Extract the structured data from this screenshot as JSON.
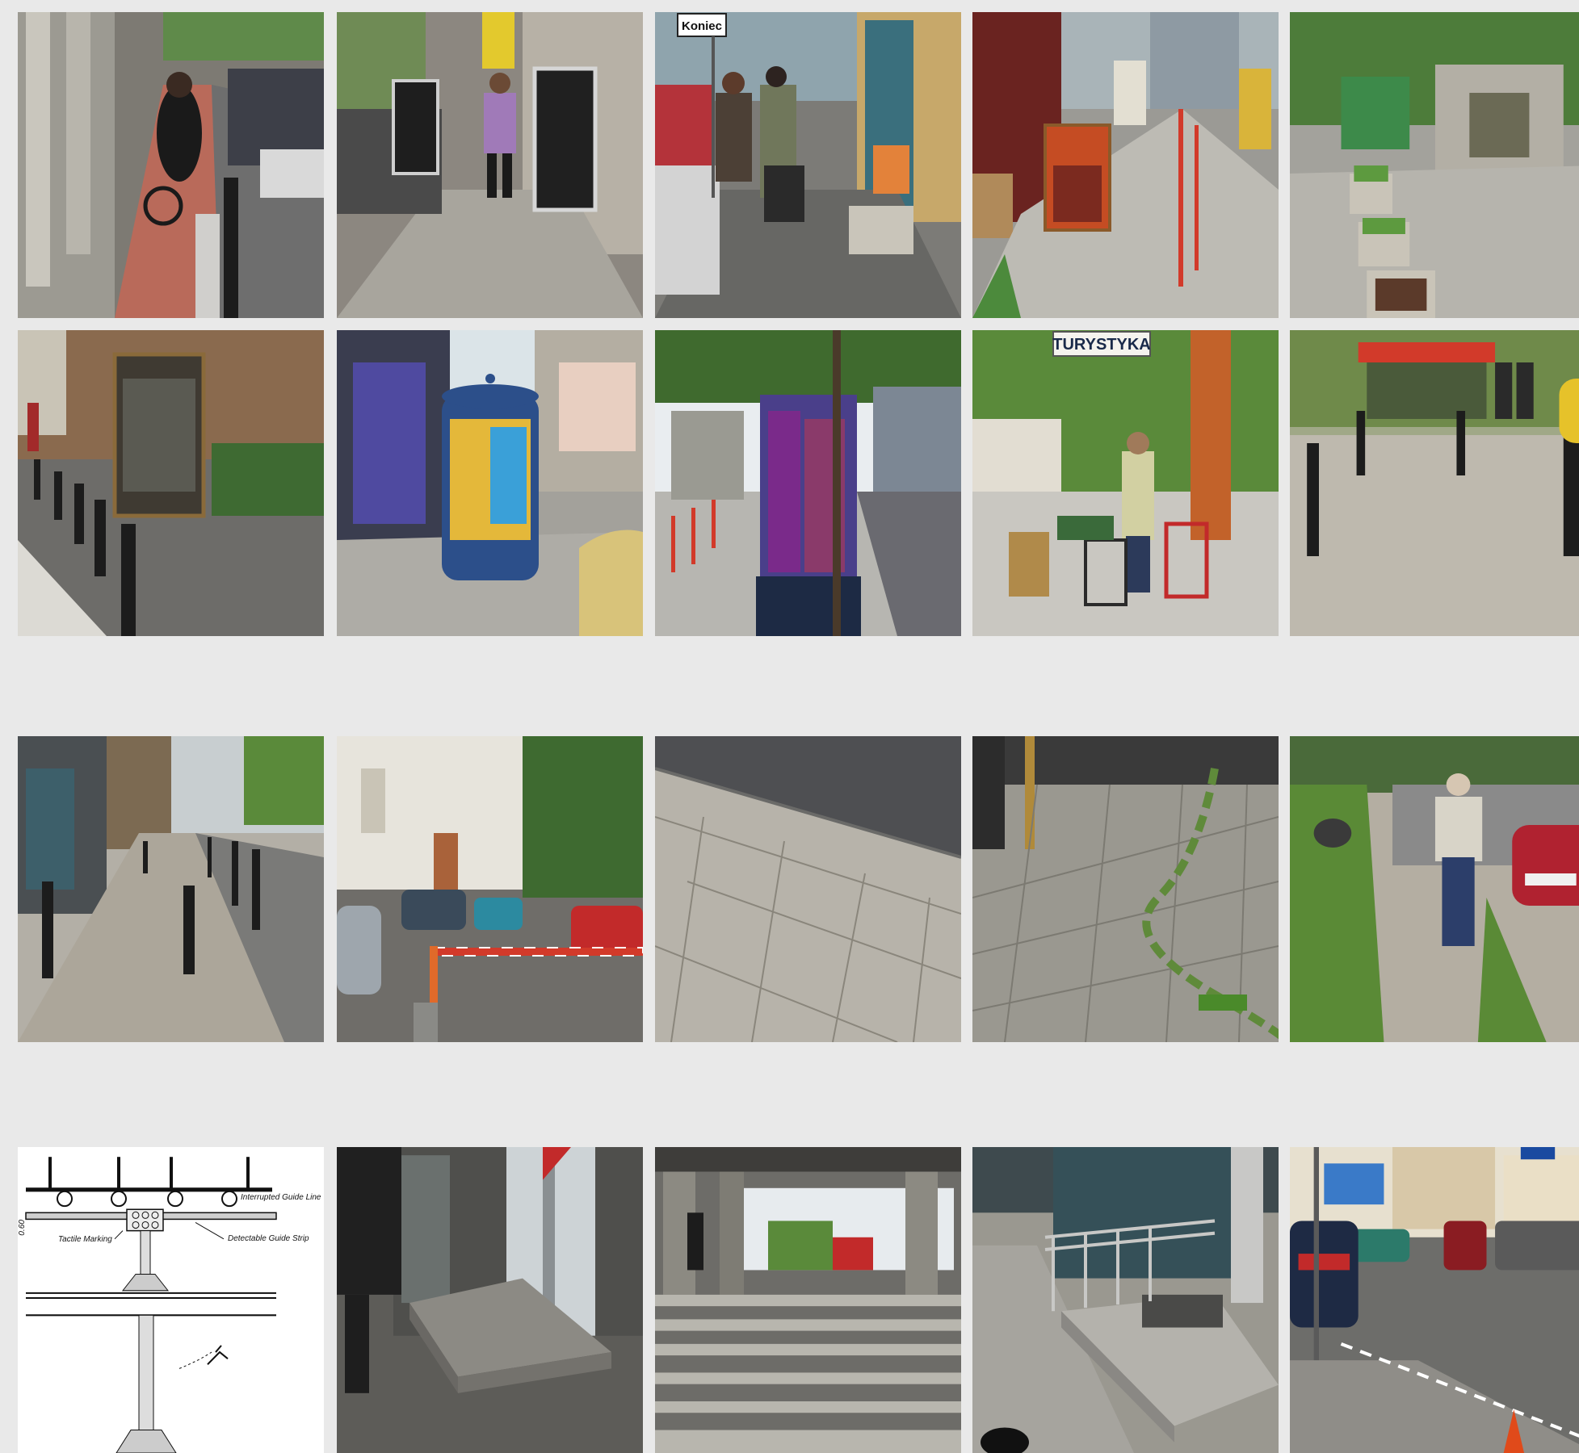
{
  "photos": {
    "r1c3": {
      "sign": "Koniec"
    },
    "r2c4": {
      "sign": "TURYSTYKA"
    },
    "r4c1": {
      "dimension": "0.60",
      "label_interrupted": "Interrupted Guide Line",
      "label_tactile": "Tactile Marking",
      "label_detectable": "Detectable Guide Strip"
    }
  },
  "colors": {
    "background": "#e9e9e9",
    "pavement": "#a9a9a3",
    "bollard": "#1c1c1c"
  }
}
